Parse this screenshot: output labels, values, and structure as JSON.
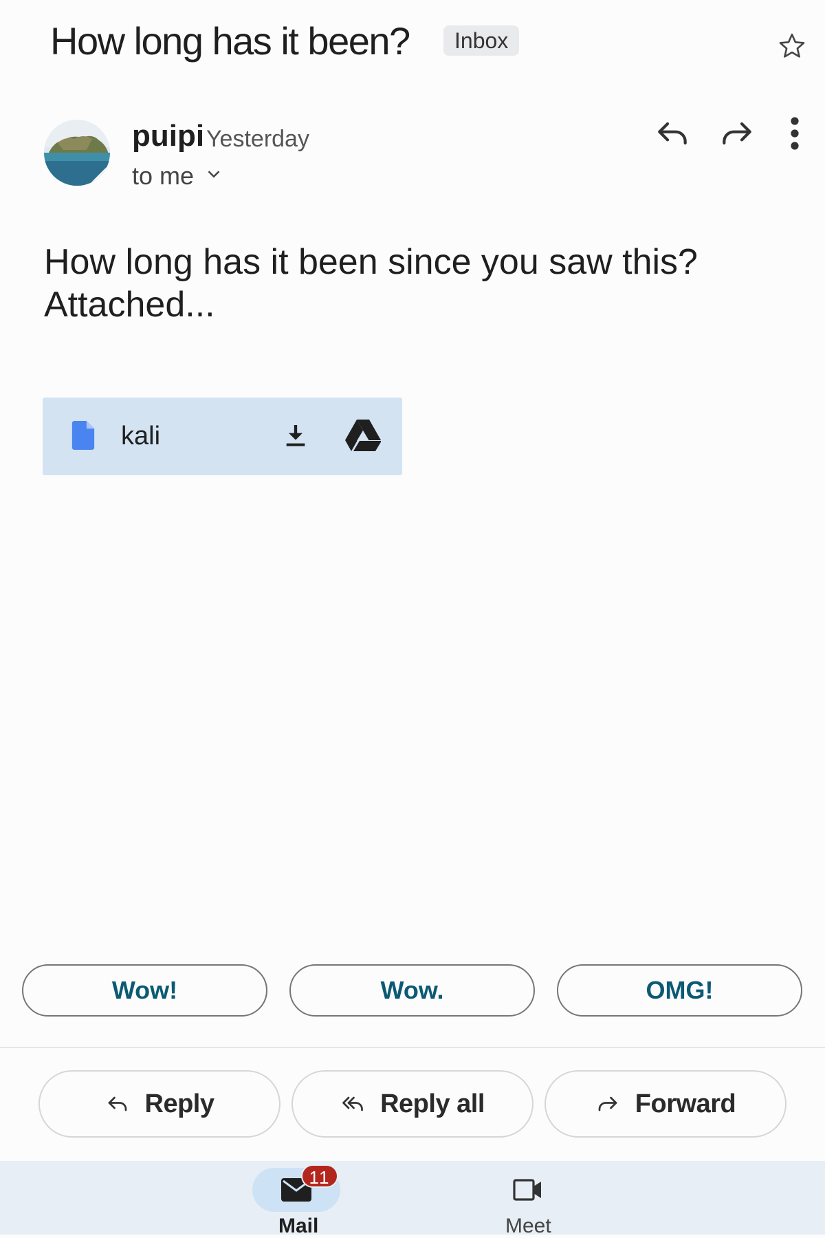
{
  "header": {
    "subject": "How long has it been?",
    "label": "Inbox"
  },
  "sender": {
    "name": "puipi",
    "time": "Yesterday",
    "to": "to me"
  },
  "body": {
    "lines": [
      "How long has it been since you saw this?",
      "Attached..."
    ]
  },
  "attachment": {
    "name": "kali"
  },
  "smart_replies": [
    "Wow!",
    "Wow.",
    "OMG!"
  ],
  "actions": {
    "reply": "Reply",
    "reply_all": "Reply all",
    "forward": "Forward"
  },
  "bottom_nav": {
    "mail_label": "Mail",
    "mail_badge": "11",
    "meet_label": "Meet"
  },
  "colors": {
    "background": "#fcfcfd",
    "attachment_bg": "#d3e3f2",
    "chip_text": "#0b5a73",
    "badge": "#b3261e",
    "nav_bg": "#e7eef5"
  },
  "icons": [
    "star-icon",
    "reply-icon",
    "forward-icon",
    "more-vert-icon",
    "chevron-down-icon",
    "doc-icon",
    "download-icon",
    "drive-icon",
    "reply-all-icon",
    "mail-icon",
    "video-icon"
  ]
}
